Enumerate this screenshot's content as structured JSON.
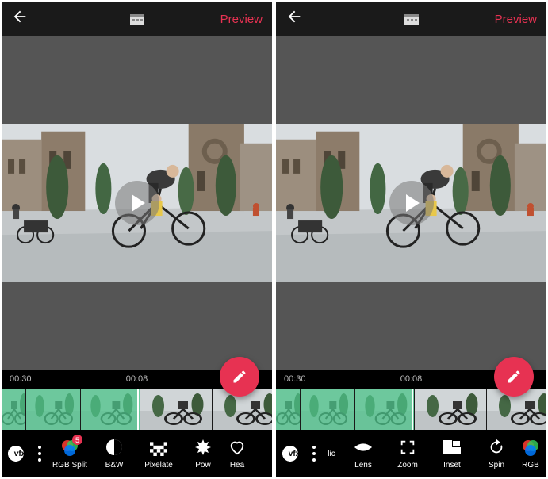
{
  "accent": "#e73252",
  "header": {
    "preview_label": "Preview"
  },
  "times": {
    "duration": "00:30",
    "position": "00:08"
  },
  "left": {
    "vfx_label": "vfx",
    "effects": [
      {
        "id": "rgb-split",
        "label": "RGB Split",
        "badge": "5"
      },
      {
        "id": "bw",
        "label": "B&W"
      },
      {
        "id": "pixelate",
        "label": "Pixelate"
      },
      {
        "id": "pow",
        "label": "Pow"
      },
      {
        "id": "hea",
        "label": "Hea"
      }
    ]
  },
  "right": {
    "vfx_label": "vfx",
    "effects": [
      {
        "id": "lic",
        "label": "lic"
      },
      {
        "id": "lens",
        "label": "Lens"
      },
      {
        "id": "zoom",
        "label": "Zoom"
      },
      {
        "id": "inset",
        "label": "Inset"
      },
      {
        "id": "spin",
        "label": "Spin"
      },
      {
        "id": "rgb",
        "label": "RGB"
      }
    ]
  }
}
